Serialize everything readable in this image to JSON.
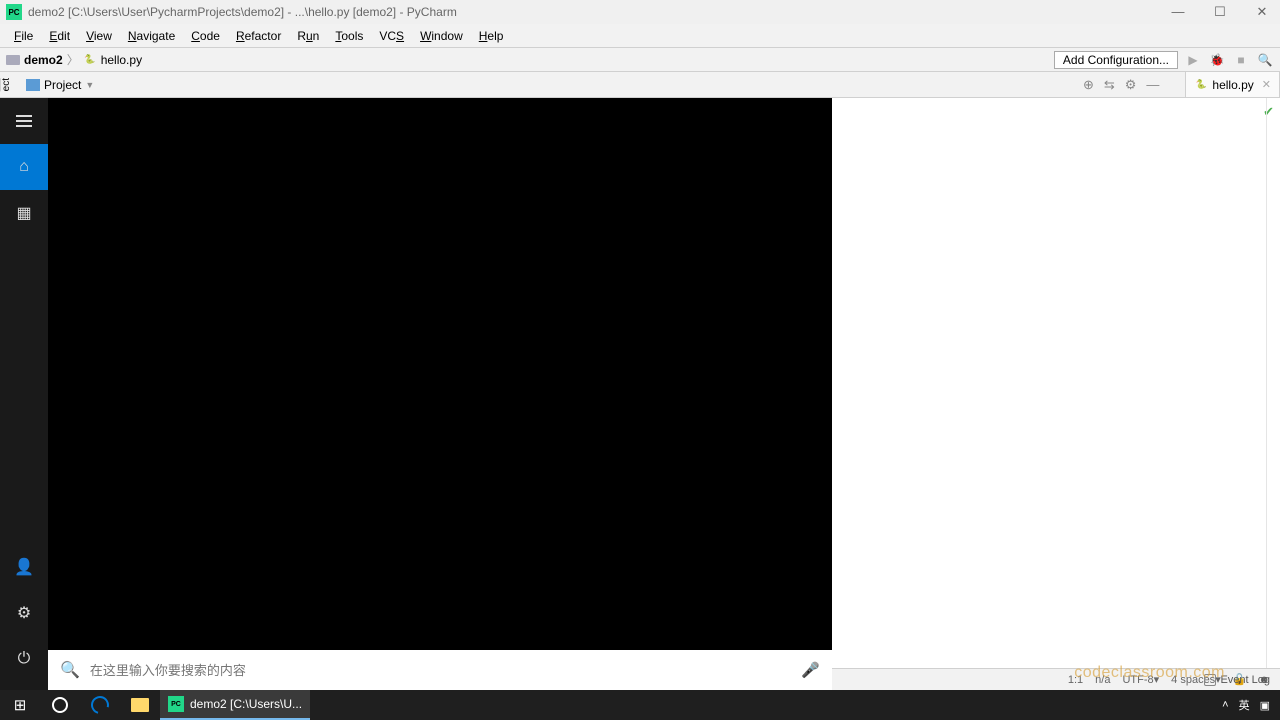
{
  "titlebar": {
    "app_badge": "PC",
    "text": "demo2 [C:\\Users\\User\\PycharmProjects\\demo2] - ...\\hello.py [demo2] - PyCharm"
  },
  "menu": [
    "File",
    "Edit",
    "View",
    "Navigate",
    "Code",
    "Refactor",
    "Run",
    "Tools",
    "VCS",
    "Window",
    "Help"
  ],
  "breadcrumb": {
    "root": "demo2",
    "file": "hello.py"
  },
  "nav": {
    "add_config": "Add Configuration..."
  },
  "project_panel": {
    "side_tab": "ect",
    "label": "Project"
  },
  "editor_tab": {
    "file": "hello.py"
  },
  "start_menu": {
    "search_placeholder": "在这里输入你要搜索的内容"
  },
  "event_log": "Event Log",
  "status": {
    "pos": "1:1",
    "lineend": "n/a",
    "encoding": "UTF-8",
    "indent": "4 spaces"
  },
  "taskbar": {
    "app_label": "demo2 [C:\\Users\\U...",
    "ime": "英"
  },
  "watermark": "codeclassroom.com"
}
